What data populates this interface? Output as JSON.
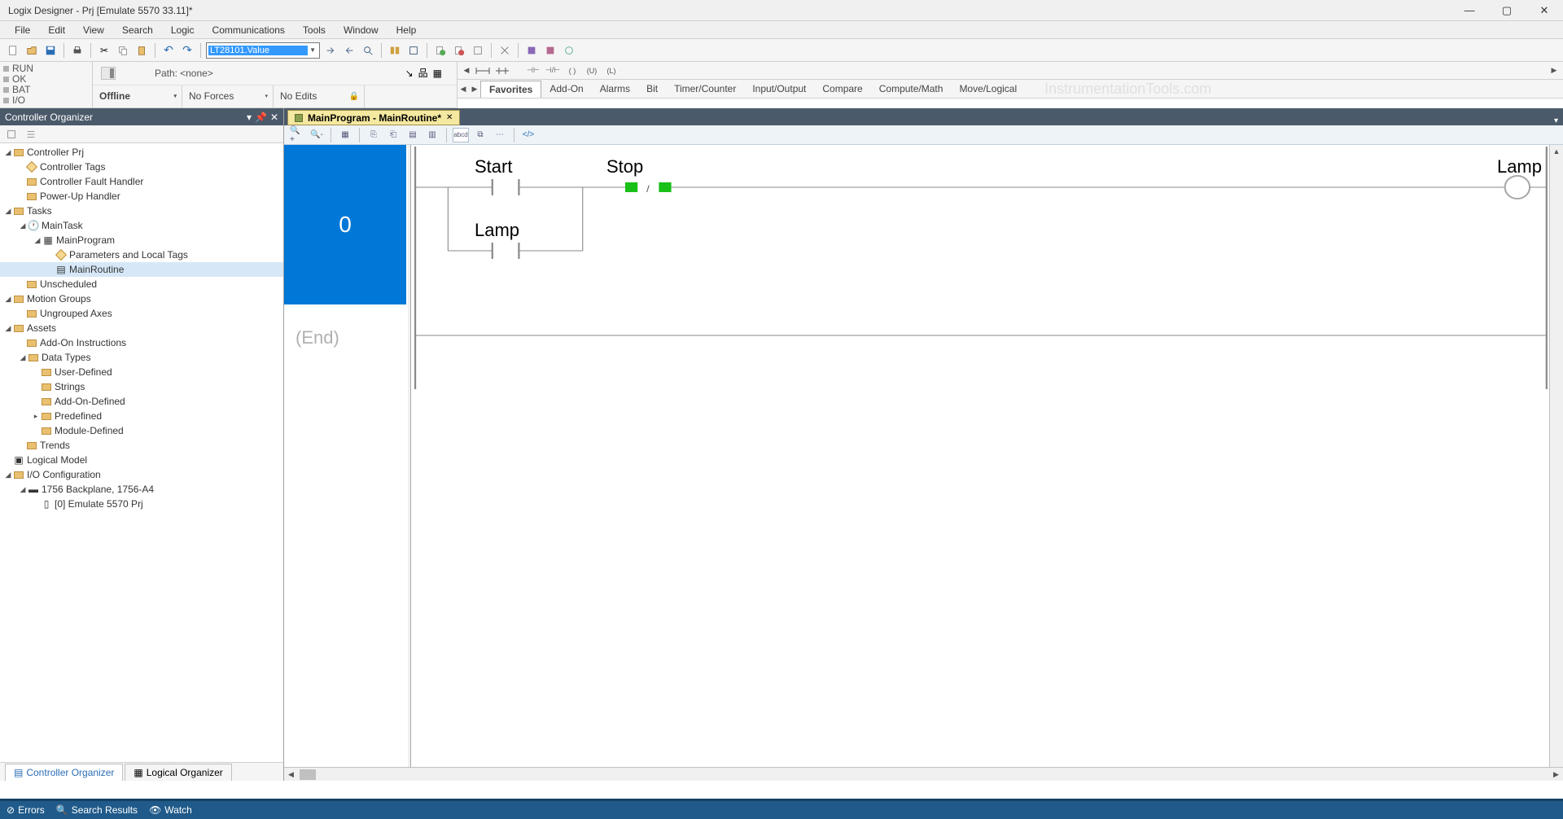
{
  "title": "Logix Designer - Prj [Emulate 5570 33.11]*",
  "menu": [
    "File",
    "Edit",
    "View",
    "Search",
    "Logic",
    "Communications",
    "Tools",
    "Window",
    "Help"
  ],
  "tag_combo_value": "LT28101.Value",
  "status_indicators": [
    "RUN",
    "OK",
    "BAT",
    "I/O"
  ],
  "path_label": "Path:",
  "path_value": "<none>",
  "status_cells": {
    "offline": "Offline",
    "forces": "No Forces",
    "edits": "No Edits"
  },
  "instr_tabs": [
    "Favorites",
    "Add-On",
    "Alarms",
    "Bit",
    "Timer/Counter",
    "Input/Output",
    "Compare",
    "Compute/Math",
    "Move/Logical"
  ],
  "watermark": "InstrumentationTools.com",
  "organizer": {
    "title": "Controller Organizer",
    "tree": {
      "controller": "Controller Prj",
      "controller_children": [
        "Controller Tags",
        "Controller Fault Handler",
        "Power-Up Handler"
      ],
      "tasks": "Tasks",
      "maintask": "MainTask",
      "mainprogram": "MainProgram",
      "mp_children": [
        "Parameters and Local Tags",
        "MainRoutine"
      ],
      "unscheduled": "Unscheduled",
      "motion": "Motion Groups",
      "motion_child": "Ungrouped Axes",
      "assets": "Assets",
      "assets_child": "Add-On Instructions",
      "datatypes": "Data Types",
      "dt_children": [
        "User-Defined",
        "Strings",
        "Add-On-Defined",
        "Predefined",
        "Module-Defined"
      ],
      "trends": "Trends",
      "logicalmodel": "Logical Model",
      "ioconfig": "I/O Configuration",
      "backplane": "1756 Backplane, 1756-A4",
      "emulate": "[0] Emulate 5570 Prj"
    },
    "bottom_tabs": [
      "Controller Organizer",
      "Logical Organizer"
    ]
  },
  "editor": {
    "tab_title": "MainProgram - MainRoutine*",
    "rung_number": "0",
    "end_label": "(End)",
    "elements": {
      "start": "Start",
      "stop": "Stop",
      "lamp": "Lamp"
    }
  },
  "footer": [
    "Errors",
    "Search Results",
    "Watch"
  ]
}
